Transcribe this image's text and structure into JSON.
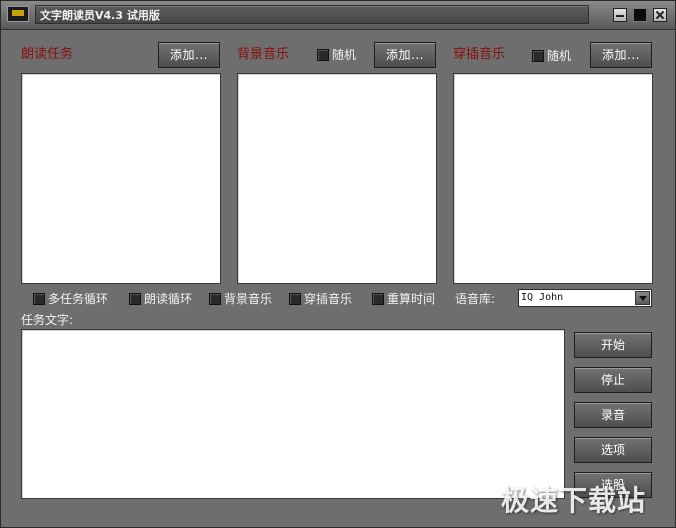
{
  "window": {
    "title": "文字朗读员V4.3 试用版",
    "icon": "app-icon"
  },
  "controls": {
    "minimize_icon": "minimize-icon",
    "maximize_icon": "maximize-icon",
    "close_icon": "close-icon"
  },
  "panels": {
    "read_tasks": {
      "label": "朗读任务",
      "add_label": "添加..."
    },
    "background_music": {
      "label": "背景音乐",
      "random_label": "随机",
      "add_label": "添加..."
    },
    "insert_music": {
      "label": "穿插音乐",
      "random_label": "随机",
      "add_label": "添加..."
    }
  },
  "options": {
    "multi_task_loop": "多任务循环",
    "read_loop": "朗读循环",
    "background_music": "背景音乐",
    "insert_music": "穿插音乐",
    "recalc_time": "重算时间"
  },
  "voice": {
    "label": "语音库:",
    "selected": "IQ John"
  },
  "task_text": {
    "label": "任务文字:",
    "value": ""
  },
  "side_buttons": {
    "start": "开始",
    "stop": "停止",
    "record": "录音",
    "options": "选项",
    "partial": "选股"
  },
  "watermark": "极速下载站",
  "colors": {
    "window_bg": "#6e6e6e",
    "label_red": "#8d0c0c",
    "text_light": "#f3f3f3"
  }
}
